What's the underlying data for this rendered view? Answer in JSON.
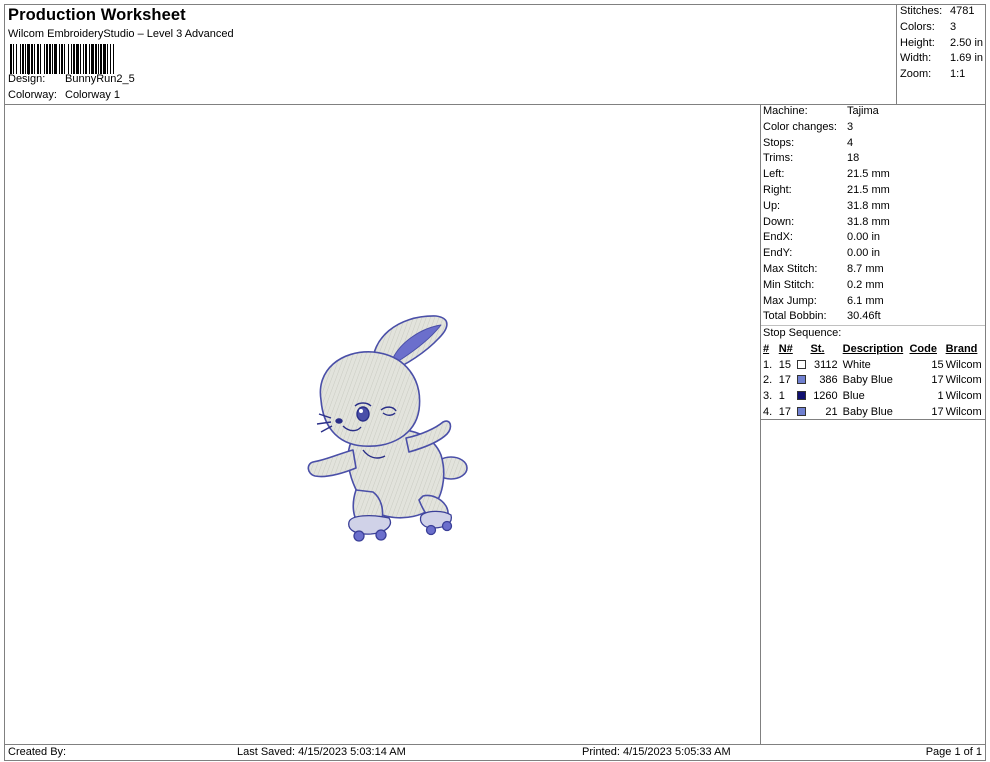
{
  "header": {
    "title": "Production Worksheet",
    "subtitle": "Wilcom EmbroideryStudio – Level 3 Advanced",
    "design_label": "Design:",
    "design_value": "BunnyRun2_5",
    "colorway_label": "Colorway:",
    "colorway_value": "Colorway 1"
  },
  "summary": [
    {
      "label": "Stitches:",
      "value": "4781"
    },
    {
      "label": "Colors:",
      "value": "3"
    },
    {
      "label": "Height:",
      "value": "2.50 in"
    },
    {
      "label": "Width:",
      "value": "1.69 in"
    },
    {
      "label": "Zoom:",
      "value": "1:1"
    }
  ],
  "machine_info": [
    {
      "label": "Machine:",
      "value": "Tajima"
    },
    {
      "label": "Color changes:",
      "value": "3"
    },
    {
      "label": "Stops:",
      "value": "4"
    },
    {
      "label": "Trims:",
      "value": "18"
    },
    {
      "label": "Left:",
      "value": "21.5 mm"
    },
    {
      "label": "Right:",
      "value": "21.5 mm"
    },
    {
      "label": "Up:",
      "value": "31.8 mm"
    },
    {
      "label": "Down:",
      "value": "31.8 mm"
    },
    {
      "label": "EndX:",
      "value": "0.00 in"
    },
    {
      "label": "EndY:",
      "value": "0.00 in"
    },
    {
      "label": "Max Stitch:",
      "value": "8.7 mm"
    },
    {
      "label": "Min Stitch:",
      "value": "0.2 mm"
    },
    {
      "label": "Max Jump:",
      "value": "6.1 mm"
    },
    {
      "label": "Total Bobbin:",
      "value": "30.46ft"
    }
  ],
  "stop_sequence": {
    "title": "Stop Sequence:",
    "columns": {
      "idx": "#",
      "n": "N#",
      "st": "St.",
      "desc": "Description",
      "code": "Code",
      "brand": "Brand"
    },
    "rows": [
      {
        "idx": "1.",
        "n": "15",
        "st": "3112",
        "desc": "White",
        "code": "15",
        "brand": "Wilcom",
        "color": "#ffffff"
      },
      {
        "idx": "2.",
        "n": "17",
        "st": "386",
        "desc": "Baby Blue",
        "code": "17",
        "brand": "Wilcom",
        "color": "#7080d0"
      },
      {
        "idx": "3.",
        "n": "1",
        "st": "1260",
        "desc": "Blue",
        "code": "1",
        "brand": "Wilcom",
        "color": "#101070"
      },
      {
        "idx": "4.",
        "n": "17",
        "st": "21",
        "desc": "Baby Blue",
        "code": "17",
        "brand": "Wilcom",
        "color": "#7080d0"
      }
    ]
  },
  "footer": {
    "created_by": "Created By:",
    "last_saved": "Last Saved: 4/15/2023 5:03:14 AM",
    "printed": "Printed: 4/15/2023 5:05:33 AM",
    "page": "Page 1 of 1"
  },
  "colors": {
    "stitch_fill": "#dfe0d8",
    "stitch_outline": "#4a4fa8",
    "accent_blue": "#6b6fcc"
  }
}
